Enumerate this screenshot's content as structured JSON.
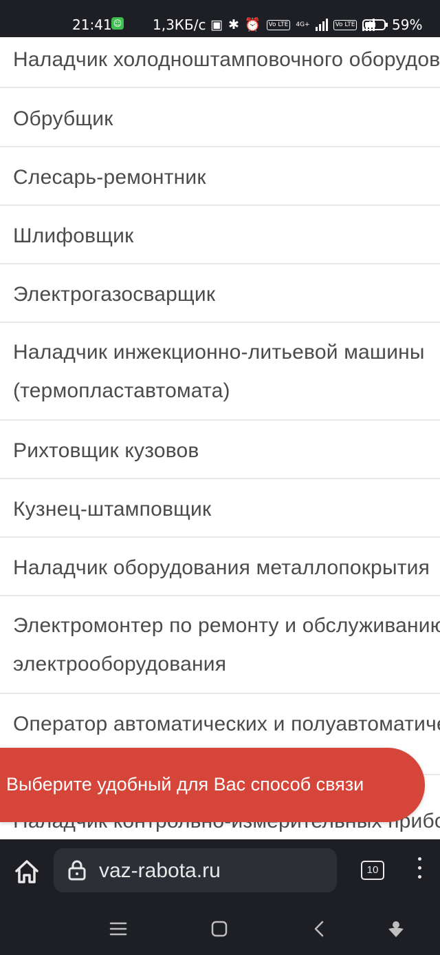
{
  "status_bar": {
    "time": "21:41",
    "speed": "1,3КБ/с",
    "network_badges": [
      "Vo LTE",
      "4G+",
      "Vo LTE"
    ],
    "battery_percent": "59%",
    "battery_level": 0.59,
    "icons": [
      "nfc-icon",
      "bluetooth-icon",
      "alarm-icon",
      "signal-icon",
      "battery-icon"
    ]
  },
  "job_list": {
    "items": [
      {
        "label": "Наладчик холодноштамповочного оборудования"
      },
      {
        "label": "Обрубщик"
      },
      {
        "label": "Слесарь-ремонтник"
      },
      {
        "label": "Шлифовщик"
      },
      {
        "label": "Электрогазосварщик"
      },
      {
        "label": "Наладчик инжекционно-литьевой машины (термопластавтомата)"
      },
      {
        "label": "Рихтовщик кузовов"
      },
      {
        "label": "Кузнец-штамповщик"
      },
      {
        "label": "Наладчик оборудования металлопокрытия"
      },
      {
        "label": "Электромонтер по ремонту и обслуживанию электрооборудования"
      },
      {
        "label": "Оператор автоматических и полуавтоматических линий"
      },
      {
        "label": "Наладчик контрольно-измерительных приборов"
      }
    ]
  },
  "contact_banner": {
    "label": "Выберите удобный для Вас способ связи",
    "color": "#d5453a"
  },
  "browser": {
    "url": "vaz-rabota.ru",
    "tab_count": "10",
    "icons": [
      "home-icon",
      "lock-icon",
      "tabs-icon",
      "more-vert-icon"
    ]
  },
  "nav_bar": {
    "icons": [
      "recents-icon",
      "home-square-icon",
      "back-icon",
      "assistant-icon"
    ]
  }
}
